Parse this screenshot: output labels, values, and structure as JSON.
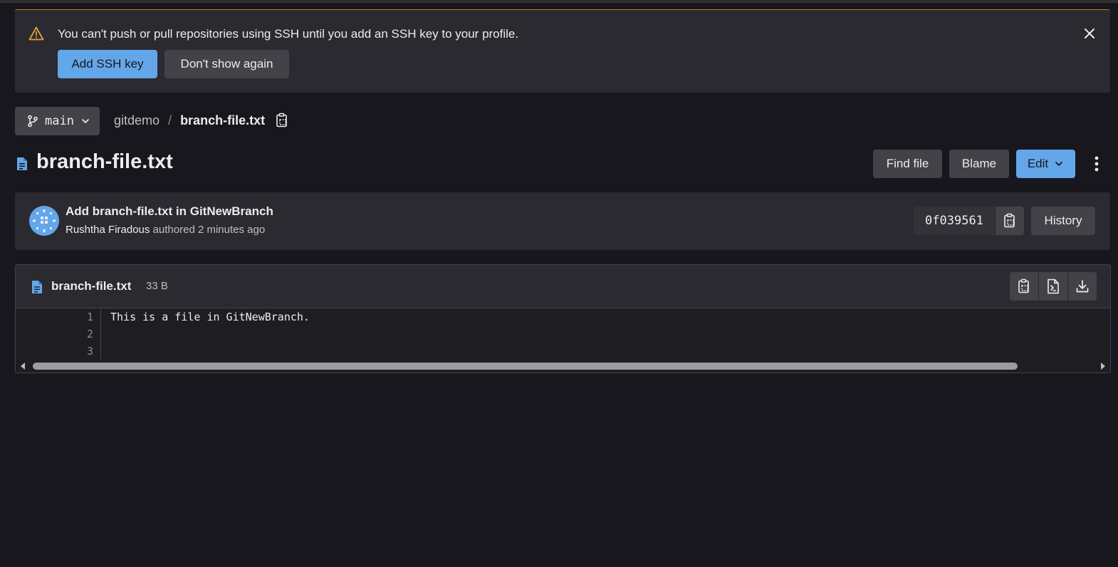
{
  "alert": {
    "message": "You can't push or pull repositories using SSH until you add an SSH key to your profile.",
    "primary_label": "Add SSH key",
    "secondary_label": "Don't show again",
    "accent_color": "#c17d10"
  },
  "breadcrumb": {
    "branch": "main",
    "project": "gitdemo",
    "separator": "/",
    "file": "branch-file.txt"
  },
  "header": {
    "title": "branch-file.txt",
    "find_file_label": "Find file",
    "blame_label": "Blame",
    "edit_label": "Edit"
  },
  "commit": {
    "title": "Add branch-file.txt in GitNewBranch",
    "author": "Rushtha Firadous",
    "meta": "authored 2 minutes ago",
    "sha": "0f039561",
    "history_label": "History"
  },
  "file": {
    "name": "branch-file.txt",
    "size": "33 B",
    "lines": [
      {
        "number": "1",
        "text": "This is a file in GitNewBranch."
      },
      {
        "number": "2",
        "text": ""
      },
      {
        "number": "3",
        "text": ""
      }
    ]
  },
  "colors": {
    "background": "#18171d",
    "panel": "#2b2a30",
    "primary": "#63a6e9",
    "button": "#434248"
  },
  "icons": {
    "alert": "warning-icon",
    "close": "close-icon",
    "branch": "branch-icon",
    "copy": "copy-icon",
    "file": "file-icon",
    "menu": "kebab-icon",
    "raw": "raw-file-icon",
    "download": "download-icon"
  }
}
